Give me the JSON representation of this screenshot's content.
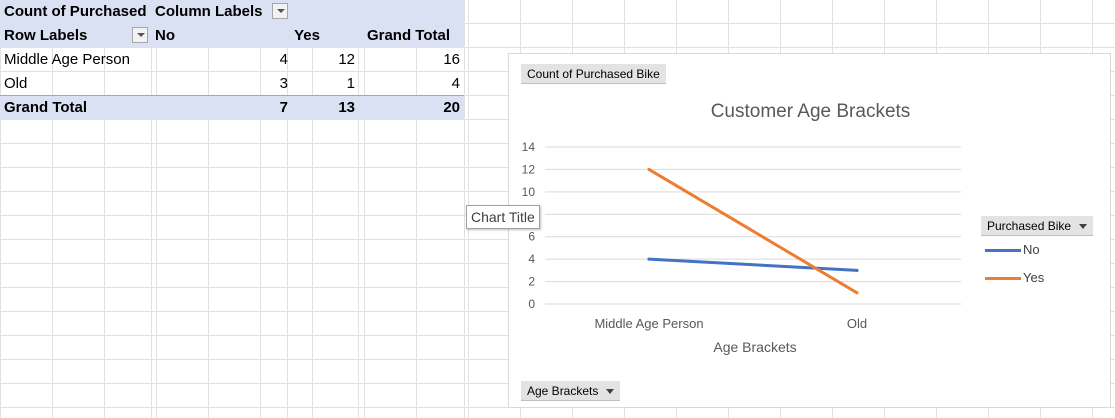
{
  "pivot": {
    "header1": {
      "label": "Count of Purchased",
      "col_labels": "Column Labels"
    },
    "header2": {
      "row_labels": "Row Labels",
      "no": "No",
      "yes": "Yes",
      "grand_total": "Grand Total"
    },
    "rows": [
      {
        "label": "Middle Age Person",
        "no": "4",
        "yes": "12",
        "total": "16"
      },
      {
        "label": "Old",
        "no": "3",
        "yes": "1",
        "total": "4"
      }
    ],
    "grand_total": {
      "label": "Grand Total",
      "no": "7",
      "yes": "13",
      "total": "20"
    },
    "header_color": "#d9e1f2"
  },
  "chart": {
    "value_field_button": "Count of Purchased Bike",
    "legend_field_button": "Purchased Bike",
    "axis_field_button": "Age Brackets",
    "tooltip": "Chart Title"
  },
  "chart_data": {
    "type": "line",
    "title": "Customer Age Brackets",
    "xlabel": "Age Brackets",
    "ylabel": "",
    "categories": [
      "Middle Age Person",
      "Old"
    ],
    "series": [
      {
        "name": "No",
        "values": [
          4,
          3
        ],
        "color": "#4472c4"
      },
      {
        "name": "Yes",
        "values": [
          12,
          1
        ],
        "color": "#ed7d31"
      }
    ],
    "ylim": [
      0,
      14
    ],
    "yticks": [
      "0",
      "2",
      "4",
      "6",
      "8",
      "10",
      "12",
      "14"
    ],
    "grid": true,
    "legend": "right"
  }
}
